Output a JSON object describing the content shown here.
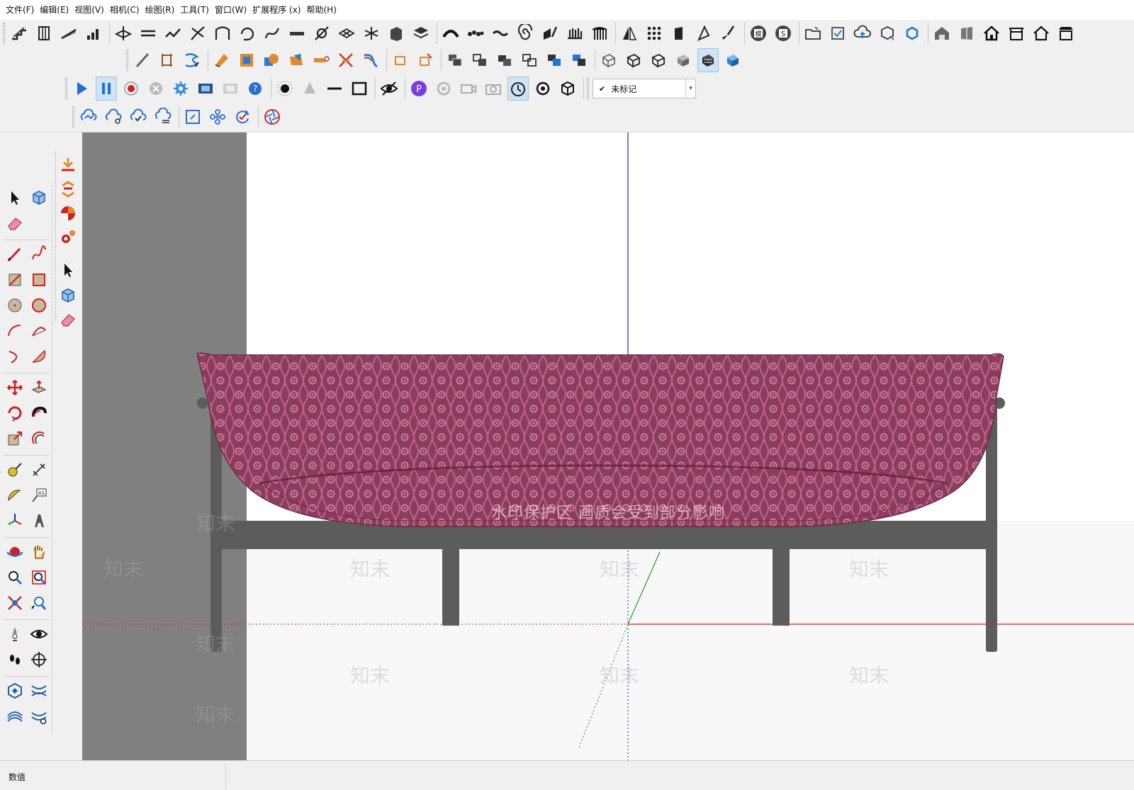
{
  "menubar": {
    "items": [
      "文件(F)",
      "编辑(E)",
      "视图(V)",
      "相机(C)",
      "绘图(R)",
      "工具(T)",
      "窗口(W)",
      "扩展程序 (x)",
      "帮助(H)"
    ]
  },
  "tag_selector": {
    "value": "未标记"
  },
  "statusbar": {
    "measurements_label": "数值"
  },
  "watermark": {
    "line": "水印保护区  画质会受到部分影响",
    "brand": "知末"
  },
  "colors": {
    "sofa_fabric": "#8a3d5c",
    "sofa_pattern": "#c0628e",
    "frame": "#5c5c5c",
    "red_axis": "#d42020",
    "green_axis": "#1ca01c",
    "blue_axis": "#2020d4",
    "wall": "#808080"
  }
}
